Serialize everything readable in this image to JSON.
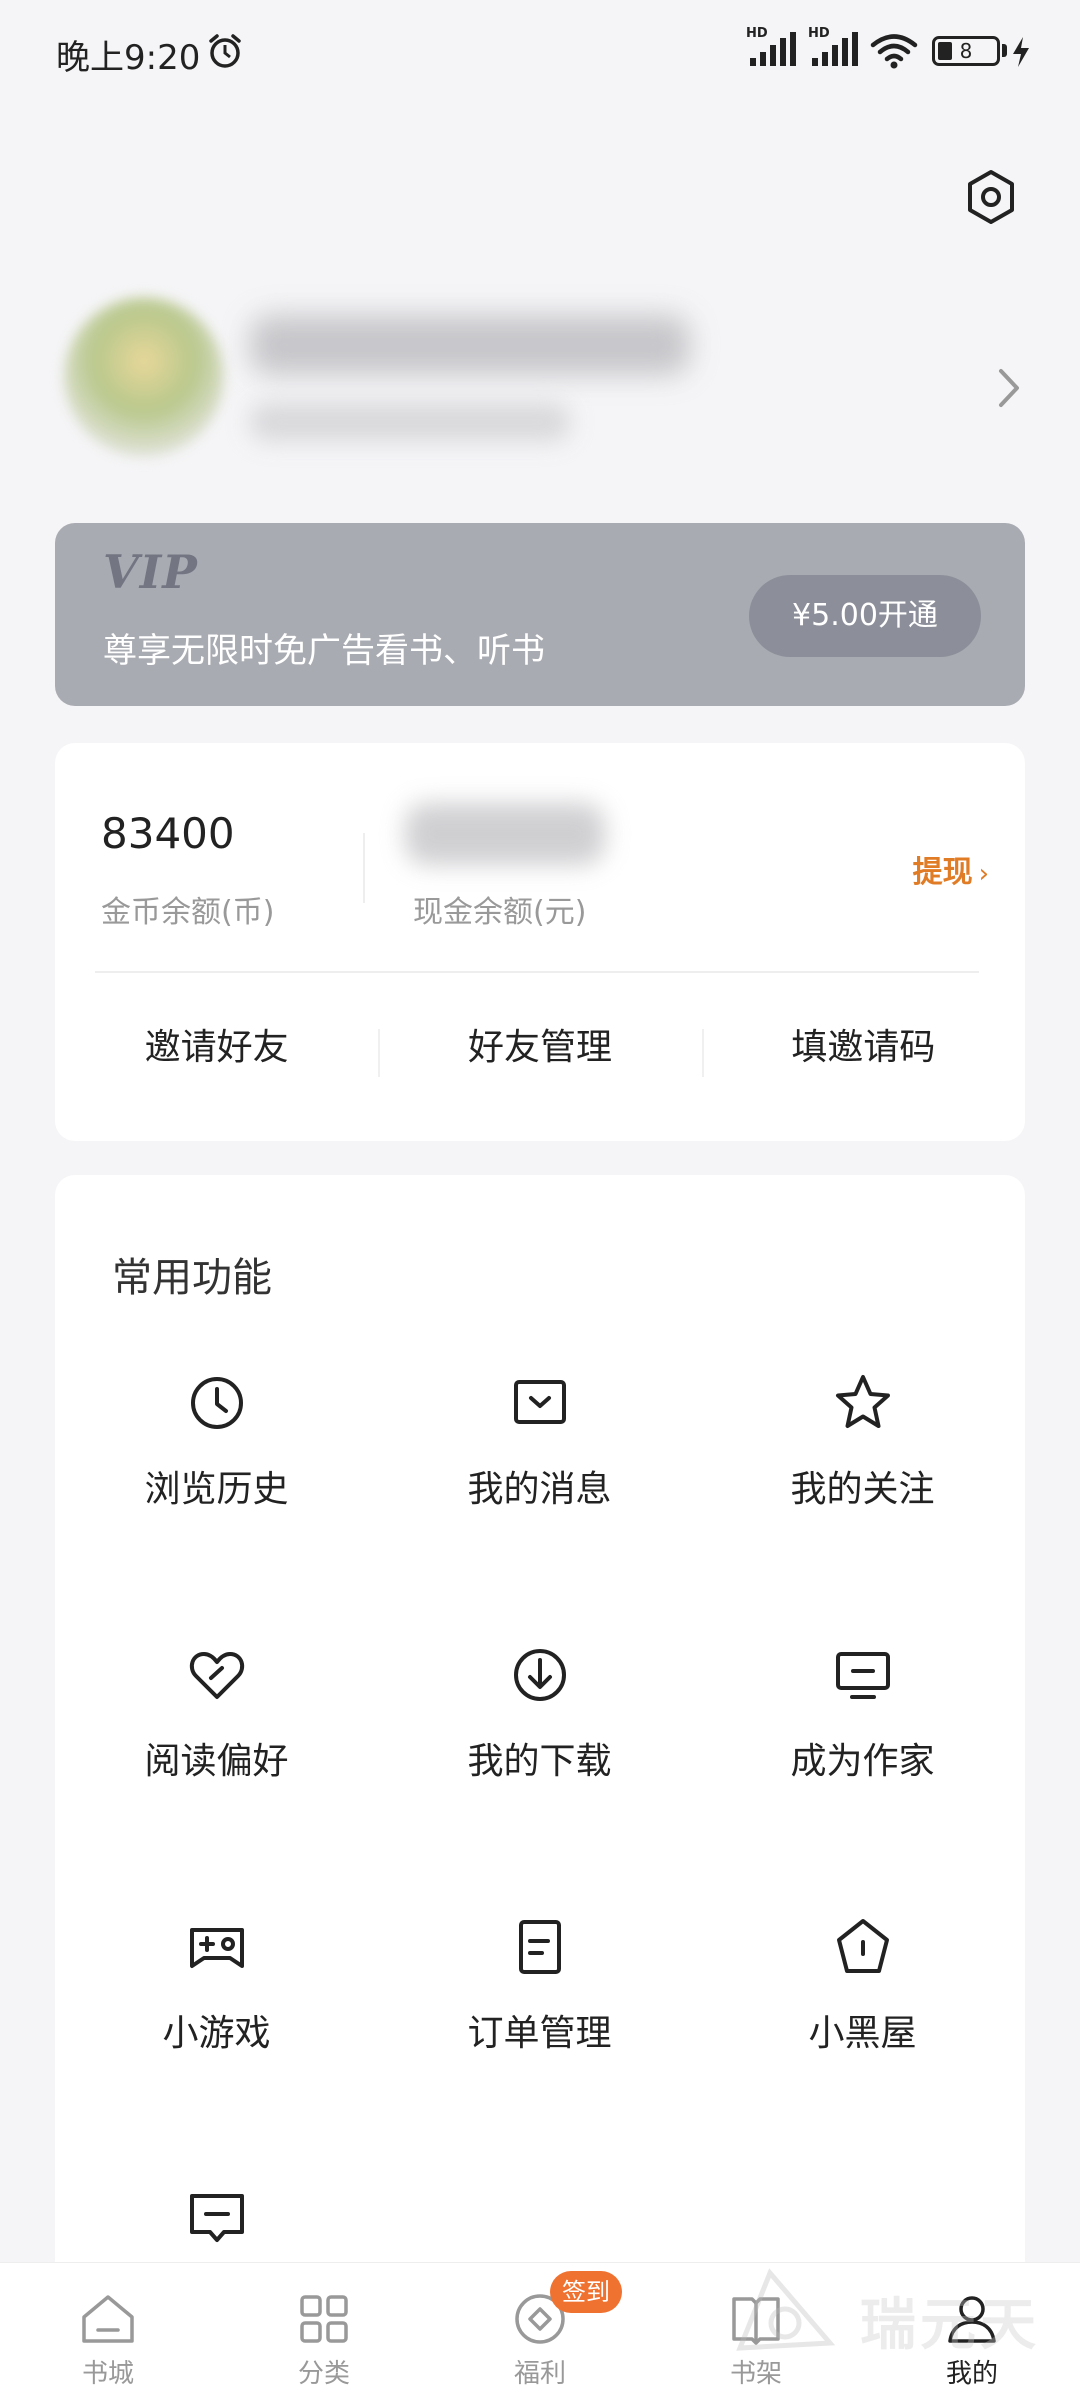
{
  "status_bar": {
    "time": "晚上9:20",
    "signal_1": "HD",
    "signal_2": "HD",
    "battery": "8"
  },
  "profile": {
    "name": "",
    "subtitle": ""
  },
  "vip": {
    "title": "VIP",
    "description": "尊享无限时免广告看书、听书",
    "button_label": "¥5.00开通"
  },
  "wallet": {
    "coin_balance": "83400",
    "coin_label": "金币余额(币)",
    "cash_label": "现金余额(元)",
    "withdraw_label": "提现",
    "actions": [
      "邀请好友",
      "好友管理",
      "填邀请码"
    ]
  },
  "functions": {
    "title": "常用功能",
    "items": [
      {
        "label": "浏览历史",
        "icon": "clock-icon"
      },
      {
        "label": "我的消息",
        "icon": "message-box-icon"
      },
      {
        "label": "我的关注",
        "icon": "star-icon"
      },
      {
        "label": "阅读偏好",
        "icon": "heart-check-icon"
      },
      {
        "label": "我的下载",
        "icon": "download-icon"
      },
      {
        "label": "成为作家",
        "icon": "monitor-icon"
      },
      {
        "label": "小游戏",
        "icon": "gamepad-icon"
      },
      {
        "label": "订单管理",
        "icon": "document-icon"
      },
      {
        "label": "小黑屋",
        "icon": "house-icon"
      },
      {
        "label": "",
        "icon": "feedback-icon"
      }
    ]
  },
  "tabs": [
    {
      "label": "书城",
      "icon": "home-icon",
      "active": false
    },
    {
      "label": "分类",
      "icon": "grid-icon",
      "active": false
    },
    {
      "label": "福利",
      "icon": "coin-icon",
      "active": false,
      "badge": "签到"
    },
    {
      "label": "书架",
      "icon": "book-icon",
      "active": false
    },
    {
      "label": "我的",
      "icon": "user-icon",
      "active": true
    }
  ],
  "watermark": "瑞元天",
  "colors": {
    "accent_orange": "#e07c26",
    "badge_orange": "#f07231",
    "vip_card": "#a9abb2",
    "page_bg": "#f5f5f7"
  }
}
